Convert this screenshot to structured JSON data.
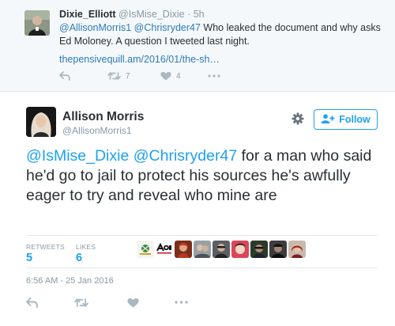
{
  "parent_tweet": {
    "name": "Dixie_Elliott",
    "handle": "@IsMise_Dixie",
    "separator": "·",
    "time": "5h",
    "mention_1": "@AllisonMorris1",
    "mention_2": "@Chrisryder47",
    "text_1": " Who leaked the document and why asks Ed Moloney. A question I tweeted last night.",
    "link": "thepensivequill.am/2016/01/the-sh…",
    "retweet_count": "7",
    "like_count": "4",
    "icons": [
      "reply-icon",
      "retweet-icon",
      "heart-icon",
      "more-icon"
    ]
  },
  "main_tweet": {
    "name": "Allison Morris",
    "handle": "@AllisonMorris1",
    "follow_label": "Follow",
    "mention_1": "@IsMise_Dixie",
    "mention_2": "@Chrisryder47",
    "text": " for a man who said he'd go to jail to protect his sources he's awfully eager to try and reveal who mine are",
    "stats": {
      "retweets_label": "RETWEETS",
      "retweets_value": "5",
      "likes_label": "LIKES",
      "likes_value": "6"
    },
    "liker_count": 9,
    "timestamp": "6:56 AM - 25 Jan 2016",
    "icons": [
      "gear-icon",
      "follow-person-icon",
      "reply-icon",
      "retweet-icon",
      "heart-icon",
      "more-icon"
    ]
  },
  "colors": {
    "accent": "#1da1f2",
    "link": "#2b7bb9",
    "muted": "#8899a6",
    "text": "#292f33",
    "parent_bg": "#f5f8fa",
    "border": "#e1e8ed"
  }
}
